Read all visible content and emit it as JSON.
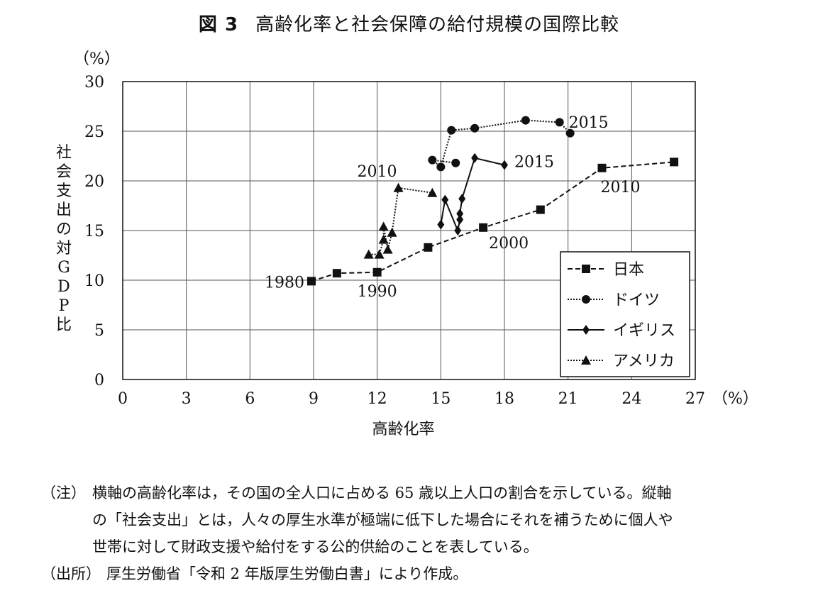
{
  "title": {
    "fig_no": "図 3",
    "text": "高齢化率と社会保障の給付規模の国際比較"
  },
  "chart_data": {
    "type": "line",
    "xlabel": "高齢化率",
    "ylabel": "社会支出の対GDP比",
    "x_unit": "（%）",
    "y_unit": "（%）",
    "xlim": [
      0,
      27
    ],
    "ylim": [
      0,
      30
    ],
    "x_ticks": [
      0,
      3,
      6,
      9,
      12,
      15,
      18,
      21,
      24,
      27
    ],
    "y_ticks": [
      0,
      5,
      10,
      15,
      20,
      25,
      30
    ],
    "grid": true,
    "legend_position": "bottom-right",
    "series": [
      {
        "name": "日本",
        "marker": "square",
        "line": "dashed",
        "points": [
          [
            8.9,
            9.9
          ],
          [
            10.1,
            10.7
          ],
          [
            12.0,
            10.8
          ],
          [
            14.4,
            13.3
          ],
          [
            17.0,
            15.3
          ],
          [
            19.7,
            17.1
          ],
          [
            22.6,
            21.3
          ],
          [
            26.0,
            21.9
          ]
        ]
      },
      {
        "name": "ドイツ",
        "marker": "circle",
        "line": "dotted",
        "points": [
          [
            15.7,
            21.8
          ],
          [
            14.6,
            22.1
          ],
          [
            15.0,
            21.4
          ],
          [
            15.5,
            25.1
          ],
          [
            16.6,
            25.3
          ],
          [
            19.0,
            26.1
          ],
          [
            20.6,
            25.9
          ],
          [
            21.1,
            24.8
          ]
        ]
      },
      {
        "name": "イギリス",
        "marker": "diamond",
        "line": "solid",
        "points": [
          [
            15.0,
            15.6
          ],
          [
            15.2,
            18.1
          ],
          [
            15.8,
            15.0
          ],
          [
            15.9,
            16.1
          ],
          [
            15.9,
            16.7
          ],
          [
            16.0,
            18.2
          ],
          [
            16.6,
            22.3
          ],
          [
            18.0,
            21.6
          ]
        ]
      },
      {
        "name": "アメリカ",
        "marker": "triangle",
        "line": "dotted",
        "points": [
          [
            11.6,
            12.6
          ],
          [
            12.1,
            12.6
          ],
          [
            12.3,
            14.1
          ],
          [
            12.3,
            15.4
          ],
          [
            12.5,
            13.1
          ],
          [
            12.7,
            14.8
          ],
          [
            13.0,
            19.3
          ],
          [
            14.6,
            18.8
          ]
        ]
      }
    ],
    "annotations": [
      {
        "text": "1980",
        "x": 8.9,
        "y": 9.9,
        "anchor": "end"
      },
      {
        "text": "1990",
        "x": 12.0,
        "y": 10.8,
        "anchor": "below"
      },
      {
        "text": "2000",
        "x": 17.0,
        "y": 15.3,
        "anchor": "below-right"
      },
      {
        "text": "2010",
        "x": 22.6,
        "y": 21.3,
        "anchor": "below"
      },
      {
        "text": "2010",
        "x": 13.0,
        "y": 19.3,
        "anchor": "above-left"
      },
      {
        "text": "2015",
        "x": 21.1,
        "y": 24.8,
        "anchor": "above-right"
      },
      {
        "text": "2015",
        "x": 18.0,
        "y": 21.6,
        "anchor": "right"
      }
    ]
  },
  "notes": {
    "note_head": "（注）",
    "note_lines": [
      "横軸の高齢化率は，その国の全人口に占める 65 歳以上人口の割合を示している。縦軸",
      "の「社会支出」とは，人々の厚生水準が極端に低下した場合にそれを補うために個人や",
      "世帯に対して財政支援や給付をする公的供給のことを表している。"
    ],
    "source_head": "（出所）",
    "source_text": "厚生労働省「令和 2 年版厚生労働白書」により作成。"
  }
}
